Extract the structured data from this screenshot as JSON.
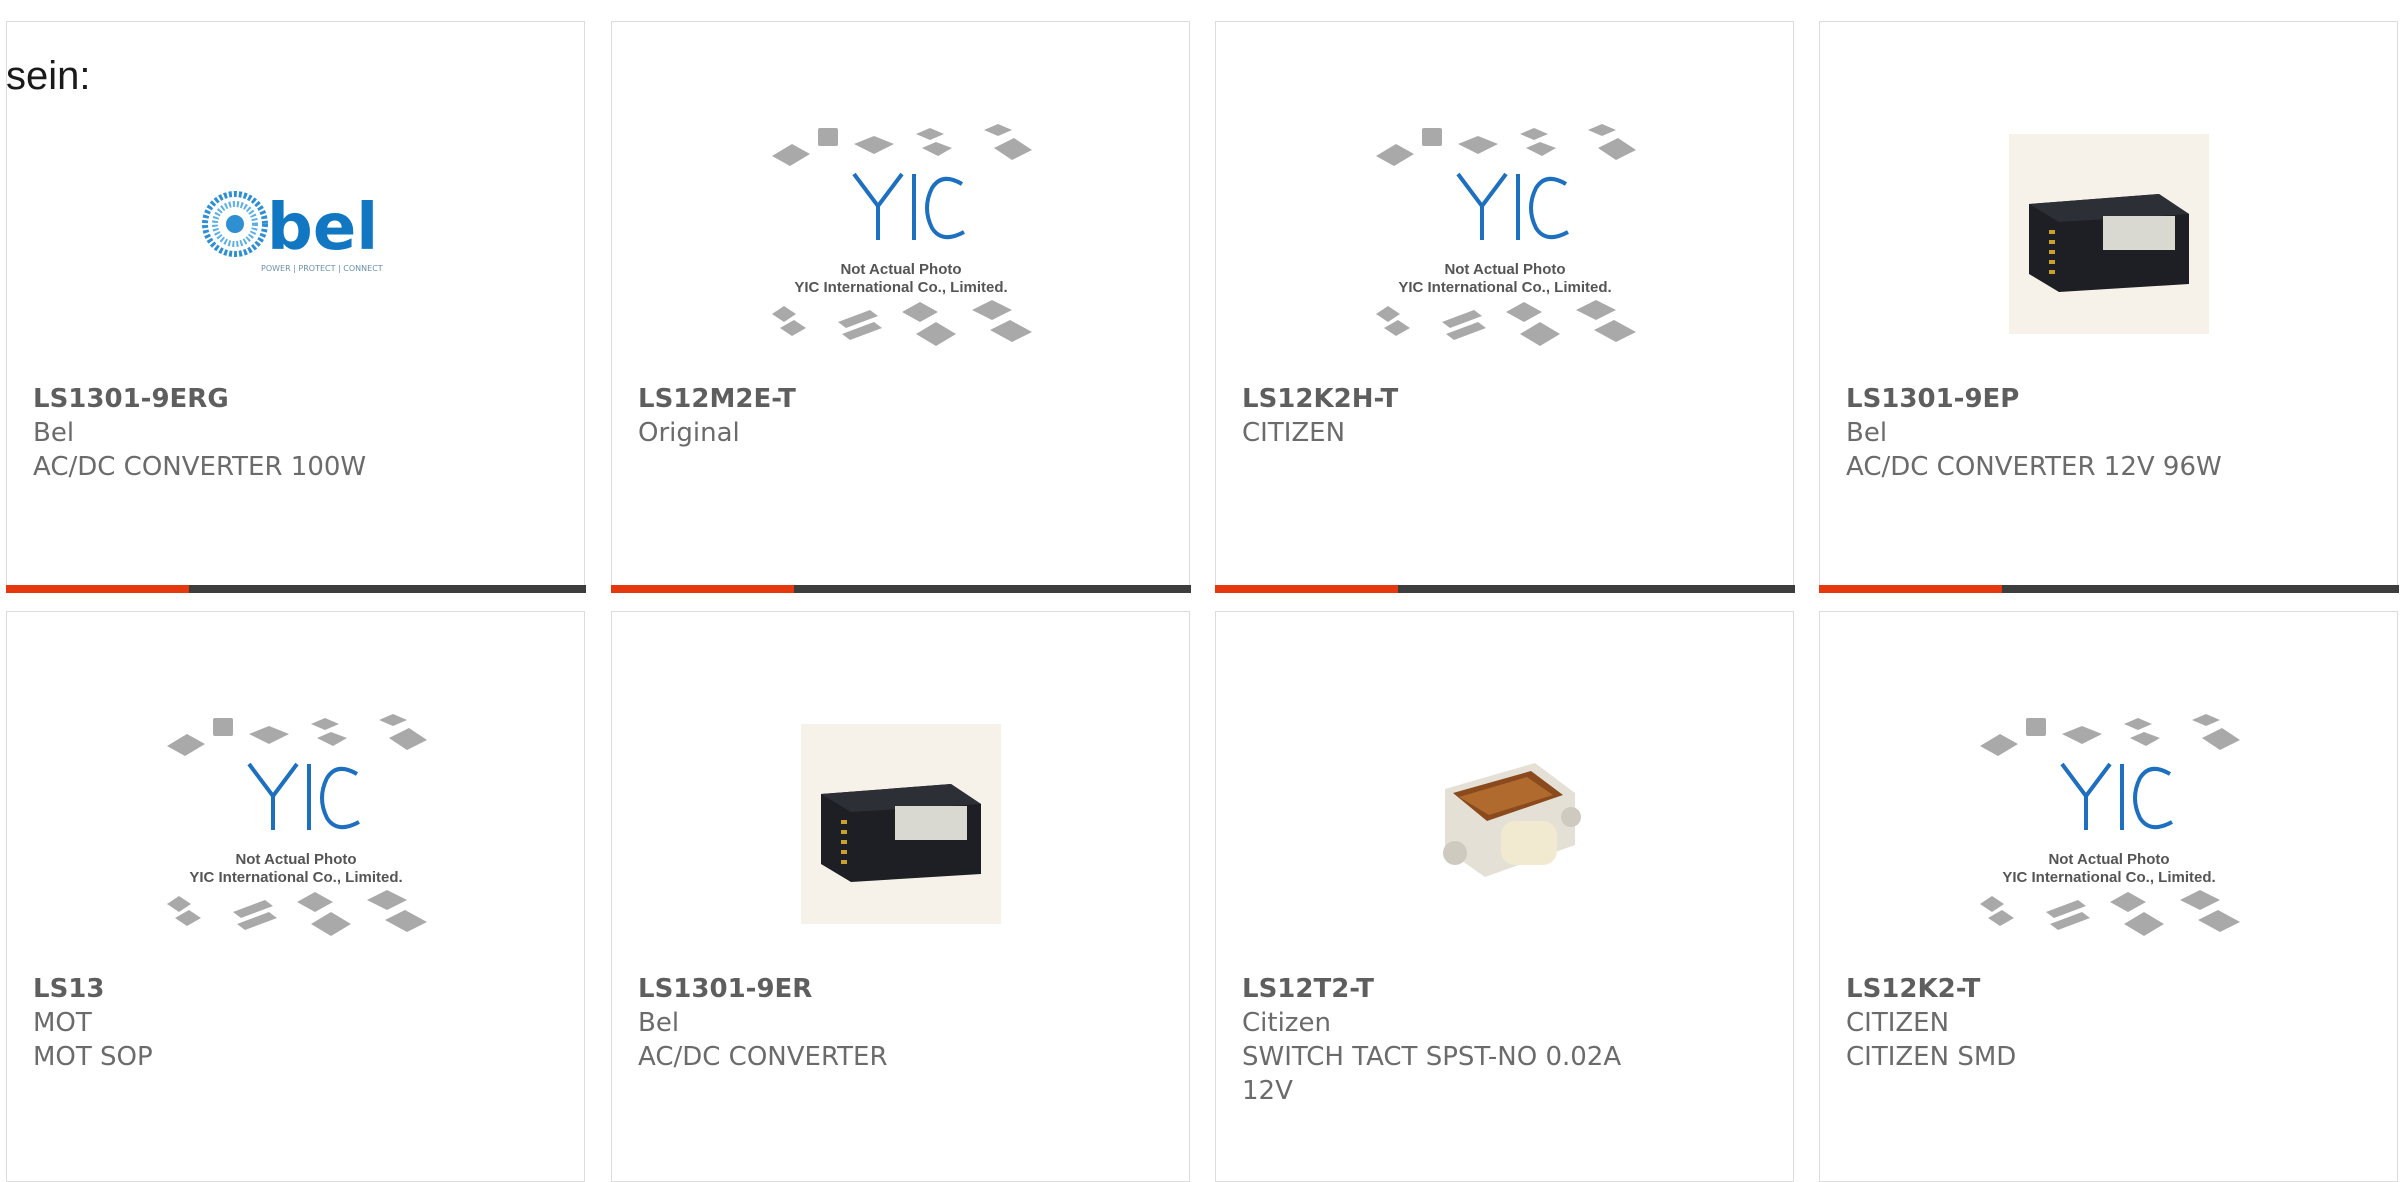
{
  "heading": "sein:",
  "colors": {
    "accent": "#e5380e",
    "bar": "#3d3d3d",
    "border": "#dcdcdc",
    "text": "#6b6b6b"
  },
  "placeholder": {
    "line1": "Not Actual Photo",
    "line2": "YIC International Co., Limited."
  },
  "brand_logo": {
    "text": "bel",
    "tagline": "POWER | PROTECT | CONNECT"
  },
  "products": [
    {
      "part": "LS1301-9ERG",
      "manufacturer": "Bel",
      "description": "AC/DC CONVERTER 100W",
      "image": "bel-logo"
    },
    {
      "part": "LS12M2E-T",
      "manufacturer": "Original",
      "description": "",
      "image": "not-actual-photo"
    },
    {
      "part": "LS12K2H-T",
      "manufacturer": "CITIZEN",
      "description": "",
      "image": "not-actual-photo"
    },
    {
      "part": "LS1301-9EP",
      "manufacturer": "Bel",
      "description": "AC/DC CONVERTER 12V 96W",
      "image": "power-module-photo"
    },
    {
      "part": "LS13",
      "manufacturer": "MOT",
      "description": "MOT SOP",
      "image": "not-actual-photo"
    },
    {
      "part": "LS1301-9ER",
      "manufacturer": "Bel",
      "description": "AC/DC CONVERTER",
      "image": "power-module-photo"
    },
    {
      "part": "LS12T2-T",
      "manufacturer": "Citizen",
      "description": "SWITCH TACT SPST-NO 0.02A 12V",
      "image": "tact-switch-photo"
    },
    {
      "part": "LS12K2-T",
      "manufacturer": "CITIZEN",
      "description": "CITIZEN SMD",
      "image": "not-actual-photo"
    }
  ]
}
